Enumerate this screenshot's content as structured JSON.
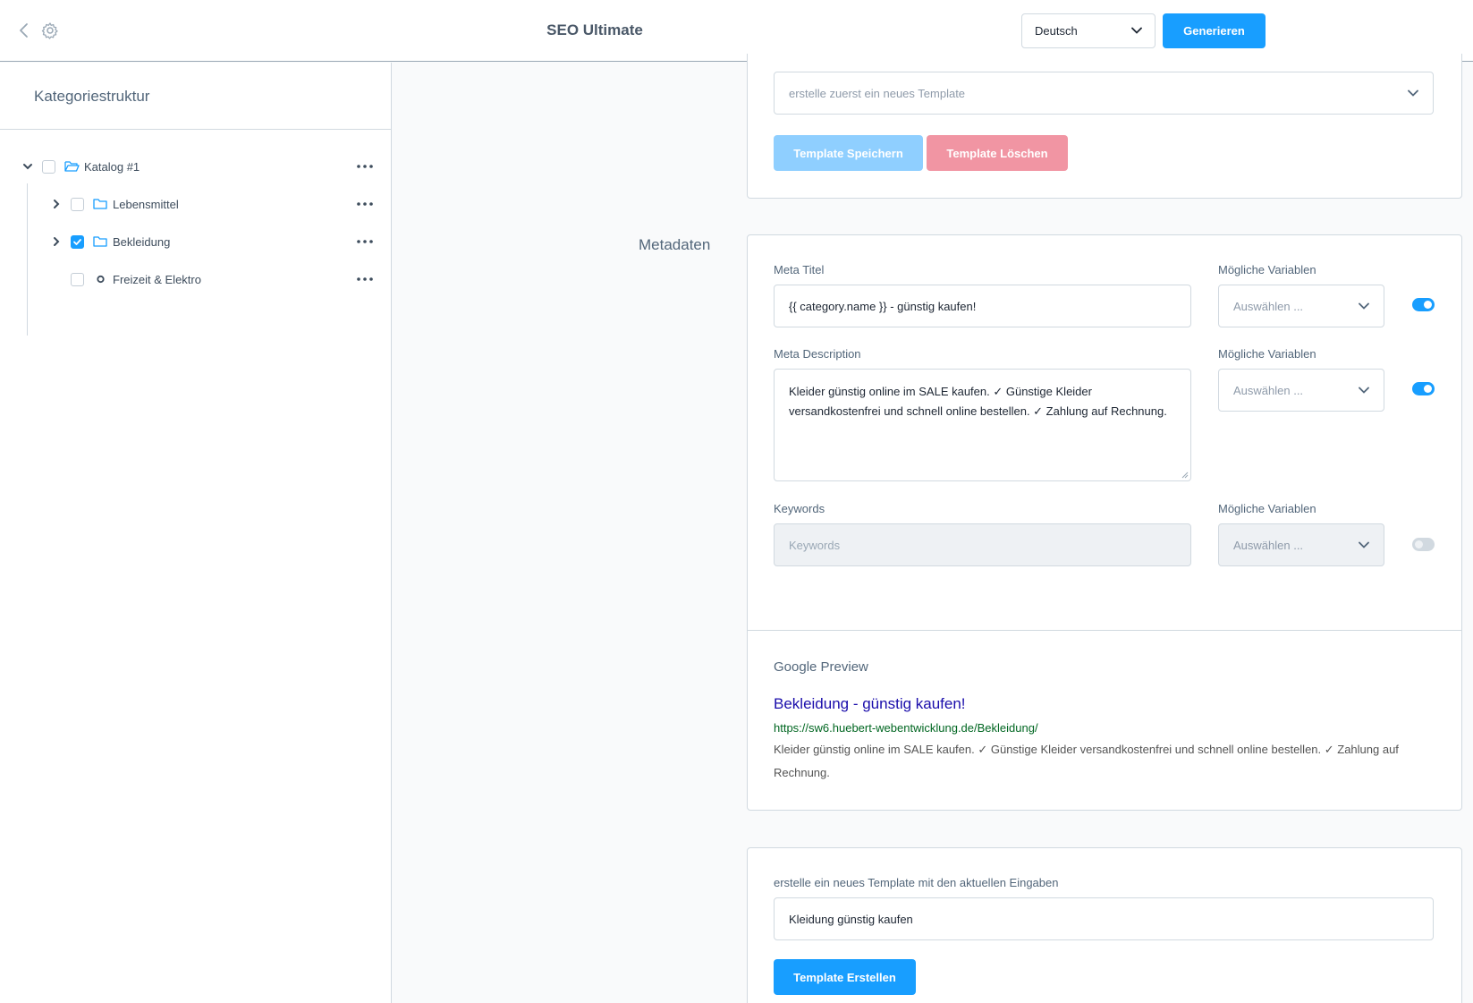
{
  "header": {
    "title": "SEO Ultimate",
    "language": "Deutsch",
    "generate_label": "Generieren"
  },
  "sidebar": {
    "title": "Kategoriestruktur",
    "items": [
      {
        "label": "Katalog #1",
        "checked": false,
        "expanded": true
      },
      {
        "label": "Lebensmittel",
        "checked": false
      },
      {
        "label": "Bekleidung",
        "checked": true
      },
      {
        "label": "Freizeit & Elektro",
        "checked": false
      }
    ]
  },
  "template_card": {
    "select_placeholder": "erstelle zuerst ein neues Template",
    "save_label": "Template Speichern",
    "delete_label": "Template Löschen"
  },
  "metadata": {
    "section_label": "Metadaten",
    "meta_title_label": "Meta Titel",
    "meta_title_value": "{{ category.name }} - günstig kaufen!",
    "variables_label": "Mögliche Variablen",
    "variables_placeholder": "Auswählen ...",
    "meta_description_label": "Meta Description",
    "meta_description_line1": "Kleider günstig online im SALE kaufen. ✓ Günstige Kleider",
    "meta_description_line2": "versandkostenfrei und schnell online bestellen. ✓ Zahlung auf Rechnung.",
    "keywords_label": "Keywords",
    "keywords_placeholder": "Keywords"
  },
  "google_preview": {
    "label": "Google Preview",
    "title": "Bekleidung - günstig kaufen!",
    "url": "https://sw6.huebert-webentwicklung.de/Bekleidung/",
    "description": "Kleider günstig online im SALE kaufen. ✓ Günstige Kleider versandkostenfrei und schnell online bestellen. ✓ Zahlung auf Rechnung."
  },
  "new_template": {
    "label": "erstelle ein neues Template mit den aktuellen Eingaben",
    "value": "Kleidung günstig kaufen",
    "create_label": "Template Erstellen"
  },
  "colors": {
    "accent": "#189eff",
    "google_title": "#1a0dab",
    "google_url": "#006621"
  }
}
